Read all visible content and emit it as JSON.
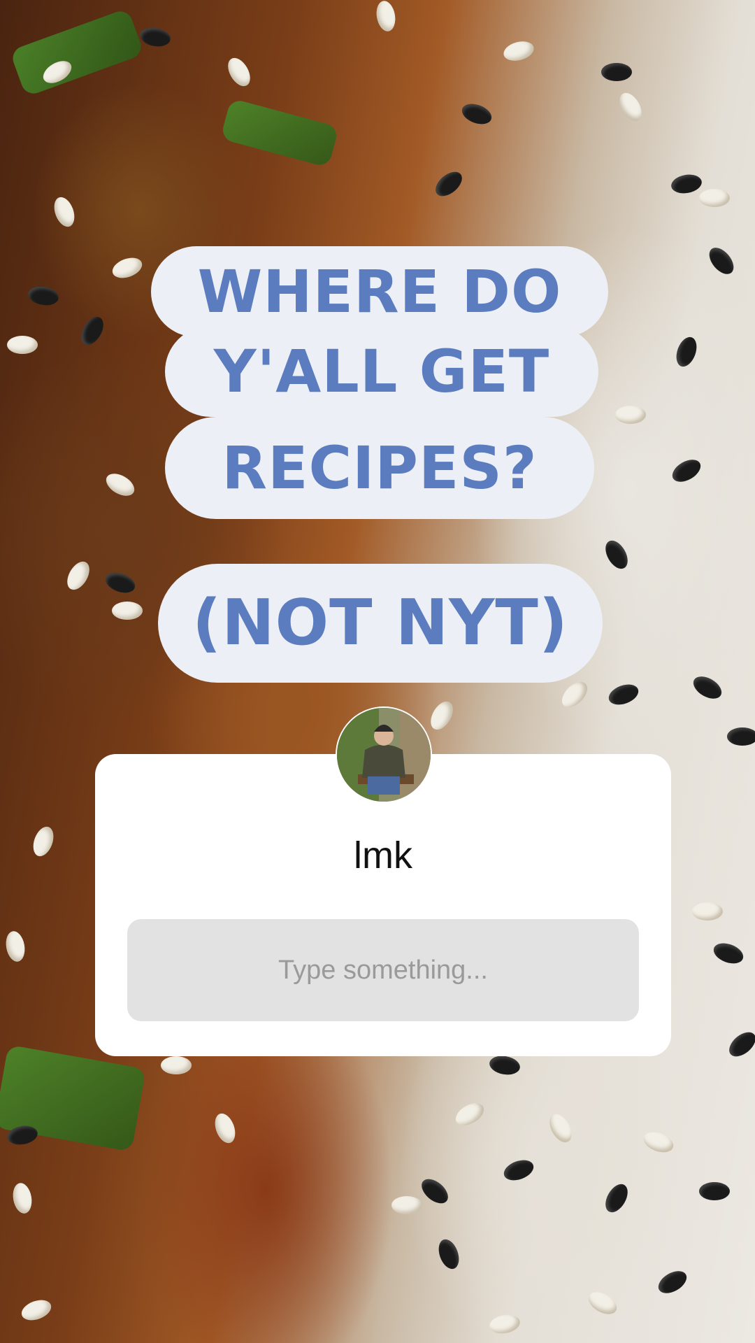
{
  "story": {
    "background_description_icon": "food-photo-background"
  },
  "question_sticker": {
    "lines": [
      "WHERE DO",
      "Y'ALL GET",
      "RECIPES?"
    ],
    "subtitle": "(NOT NYT)",
    "text_color": "#5b7cbf",
    "pill_color": "#eceff5"
  },
  "question_box": {
    "prompt": "lmk",
    "placeholder": "Type something...",
    "avatar_icon": "avatar-icon"
  }
}
